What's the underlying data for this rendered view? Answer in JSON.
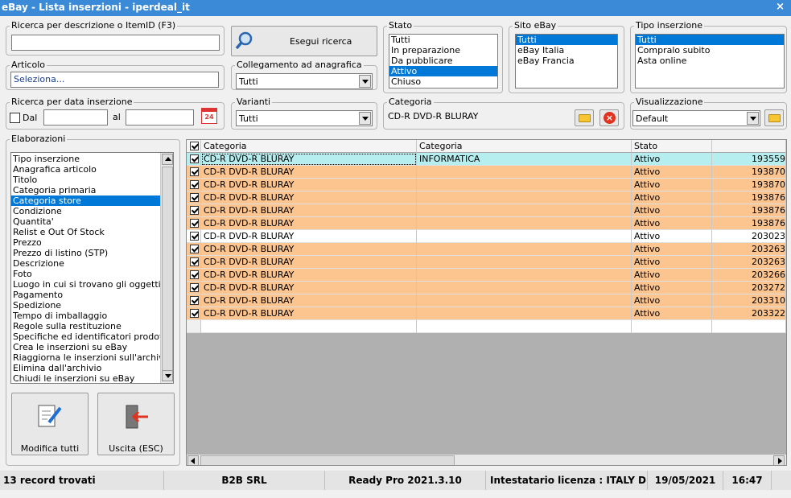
{
  "window": {
    "title": "eBay - Lista inserzioni - iperdeal_it",
    "close": "×"
  },
  "search": {
    "label": "Ricerca per descrizione o ItemID (F3)",
    "value": "",
    "button": "Esegui ricerca"
  },
  "articolo": {
    "label": "Articolo",
    "value": "Seleziona..."
  },
  "collegamento": {
    "label": "Collegamento ad anagrafica",
    "value": "Tutti"
  },
  "stato": {
    "label": "Stato",
    "items": [
      "Tutti",
      "In preparazione",
      "Da pubblicare",
      "Attivo",
      "Chiuso"
    ],
    "selected": "Attivo"
  },
  "sito": {
    "label": "Sito eBay",
    "items": [
      "Tutti",
      "eBay Italia",
      "eBay Francia"
    ],
    "selected": "Tutti"
  },
  "tipo": {
    "label": "Tipo inserzione",
    "items": [
      "Tutti",
      "Compralo subito",
      "Asta online"
    ],
    "selected": "Tutti"
  },
  "data": {
    "label": "Ricerca per data inserzione",
    "dal": "Dal",
    "al": "al",
    "calendar": "24"
  },
  "varianti": {
    "label": "Varianti",
    "value": "Tutti"
  },
  "categoria": {
    "label": "Categoria",
    "value": "CD-R DVD-R BLURAY"
  },
  "visualizzazione": {
    "label": "Visualizzazione",
    "value": "Default"
  },
  "elaborazioni": {
    "label": "Elaborazioni",
    "selected": "Categoria store",
    "items": [
      "Tipo inserzione",
      "Anagrafica articolo",
      "Titolo",
      "Categoria primaria",
      "Categoria store",
      "Condizione",
      "Quantita'",
      "Relist e Out Of Stock",
      "Prezzo",
      "Prezzo di listino (STP)",
      "Descrizione",
      "Foto",
      "Luogo in cui si trovano gli oggetti",
      "Pagamento",
      "Spedizione",
      "Tempo di imballaggio",
      "Regole sulla restituzione",
      "Specifiche ed identificatori prodotto",
      "Crea le inserzioni su eBay",
      "Riaggiorna le inserzioni sull'archivio",
      "Elimina dall'archivio",
      "Chiudi le inserzioni su eBay"
    ]
  },
  "buttons": {
    "modifica": "Modifica tutti",
    "uscita": "Uscita (ESC)"
  },
  "grid": {
    "headers": [
      "Categoria",
      "Categoria",
      "Stato",
      ""
    ],
    "rows": [
      {
        "cat": "CD-R DVD-R BLURAY",
        "cat2": "INFORMATICA",
        "stato": "Attivo",
        "id": "193559",
        "color": "#b6eef0"
      },
      {
        "cat": "CD-R DVD-R BLURAY",
        "cat2": "",
        "stato": "Attivo",
        "id": "193870",
        "color": "#fcc48e"
      },
      {
        "cat": "CD-R DVD-R BLURAY",
        "cat2": "",
        "stato": "Attivo",
        "id": "193870",
        "color": "#fcc48e"
      },
      {
        "cat": "CD-R DVD-R BLURAY",
        "cat2": "",
        "stato": "Attivo",
        "id": "193876",
        "color": "#fcc48e"
      },
      {
        "cat": "CD-R DVD-R BLURAY",
        "cat2": "",
        "stato": "Attivo",
        "id": "193876",
        "color": "#fcc48e"
      },
      {
        "cat": "CD-R DVD-R BLURAY",
        "cat2": "",
        "stato": "Attivo",
        "id": "193876",
        "color": "#fcc48e"
      },
      {
        "cat": "CD-R DVD-R BLURAY",
        "cat2": "",
        "stato": "Attivo",
        "id": "203023",
        "color": "#ffffff"
      },
      {
        "cat": "CD-R DVD-R BLURAY",
        "cat2": "",
        "stato": "Attivo",
        "id": "203263",
        "color": "#fcc48e"
      },
      {
        "cat": "CD-R DVD-R BLURAY",
        "cat2": "",
        "stato": "Attivo",
        "id": "203263",
        "color": "#fcc48e"
      },
      {
        "cat": "CD-R DVD-R BLURAY",
        "cat2": "",
        "stato": "Attivo",
        "id": "203266",
        "color": "#fcc48e"
      },
      {
        "cat": "CD-R DVD-R BLURAY",
        "cat2": "",
        "stato": "Attivo",
        "id": "203272",
        "color": "#fcc48e"
      },
      {
        "cat": "CD-R DVD-R BLURAY",
        "cat2": "",
        "stato": "Attivo",
        "id": "203310",
        "color": "#fcc48e"
      },
      {
        "cat": "CD-R DVD-R BLURAY",
        "cat2": "",
        "stato": "Attivo",
        "id": "203322",
        "color": "#fcc48e"
      }
    ]
  },
  "statusbar": {
    "records": "13 record trovati",
    "company": "B2B SRL",
    "version": "Ready Pro 2021.3.10",
    "license": "Intestatario licenza : ITALY DEVELO",
    "date": "19/05/2021",
    "time": "16:47"
  }
}
